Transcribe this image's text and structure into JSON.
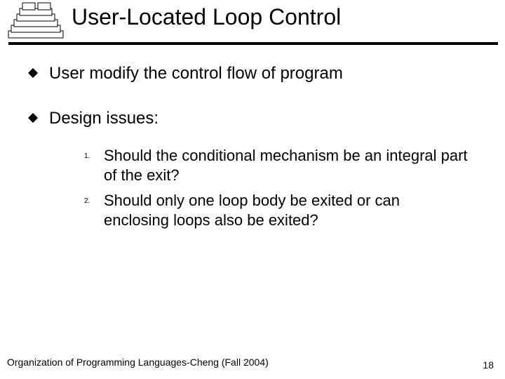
{
  "title": "User-Located Loop Control",
  "bullets": [
    "User modify the control flow of program",
    "Design issues:"
  ],
  "numbered": [
    {
      "n": "1.",
      "text": "Should the conditional mechanism be an integral part of the exit?"
    },
    {
      "n": "2.",
      "text": "Should only one loop body be exited or can enclosing loops also be exited?"
    }
  ],
  "footer": "Organization of Programming Languages-Cheng (Fall 2004)",
  "page_number": "18",
  "icon_name": "layered-books-icon"
}
